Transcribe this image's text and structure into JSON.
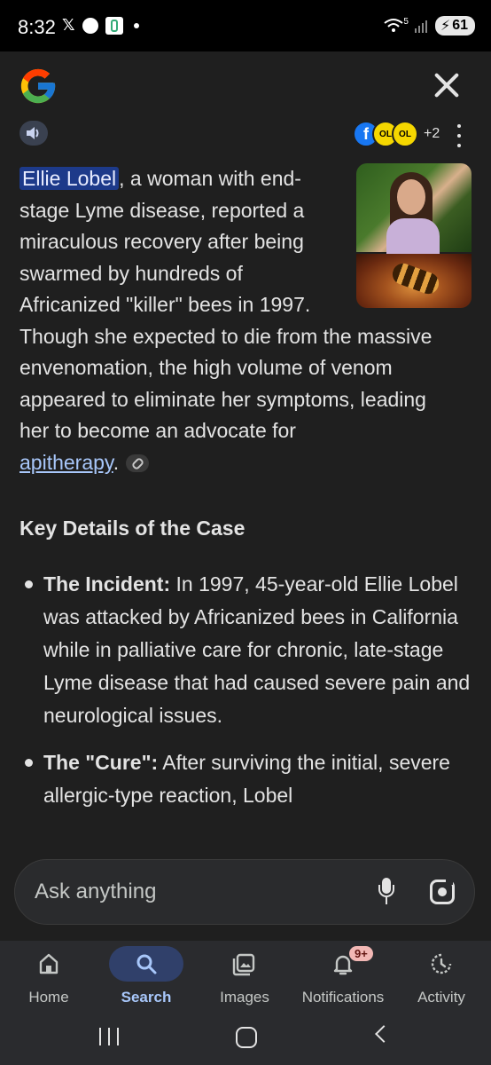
{
  "status_bar": {
    "time": "8:32",
    "notification_icons": [
      "x-icon",
      "sports-ball-icon",
      "app-icon"
    ],
    "signal_label": "5",
    "battery": "61"
  },
  "header": {
    "logo": "google-g-logo",
    "close_icon": "close-icon"
  },
  "toolbar": {
    "speaker_icon": "speaker-icon",
    "sources": [
      "f",
      "OL",
      "OL"
    ],
    "sources_more": "+2",
    "more_icon": "more-vert-icon"
  },
  "answer": {
    "highlight": "Ellie Lobel",
    "lines": [
      ", a woman with end-",
      "stage Lyme disease, reported a",
      "miraculous recovery after being",
      "swarmed by hundreds of",
      "Africanized \"killer\" bees in 1997.",
      "Though she expected to die from the massive",
      "envenomation, the high volume of venom",
      "appeared to eliminate her symptoms, leading",
      "her to become an advocate for"
    ],
    "link_text": "apitherapy",
    "link_suffix": "."
  },
  "section": {
    "heading": "Key Details of the Case",
    "bullets": [
      {
        "title": "The Incident:",
        "text": " In 1997, 45-year-old Ellie Lobel was attacked by Africanized bees in California while in palliative care for chronic, late-stage Lyme disease that had caused severe pain and neurological issues."
      },
      {
        "title": "The \"Cure\":",
        "text": " After surviving the initial, severe allergic-type reaction, Lobel"
      }
    ]
  },
  "ask": {
    "placeholder": "Ask anything",
    "mic_icon": "mic-icon",
    "lens_icon": "lens-icon"
  },
  "nav": {
    "items": [
      {
        "label": "Home",
        "icon": "home-icon"
      },
      {
        "label": "Search",
        "icon": "search-icon"
      },
      {
        "label": "Images",
        "icon": "images-icon"
      },
      {
        "label": "Notifications",
        "icon": "bell-icon",
        "badge": "9+"
      },
      {
        "label": "Activity",
        "icon": "activity-icon"
      }
    ],
    "active": "Search"
  },
  "colors": {
    "background": "#1f1f1f",
    "accent": "#a8c7fa",
    "highlight": "#1d3a8a"
  }
}
